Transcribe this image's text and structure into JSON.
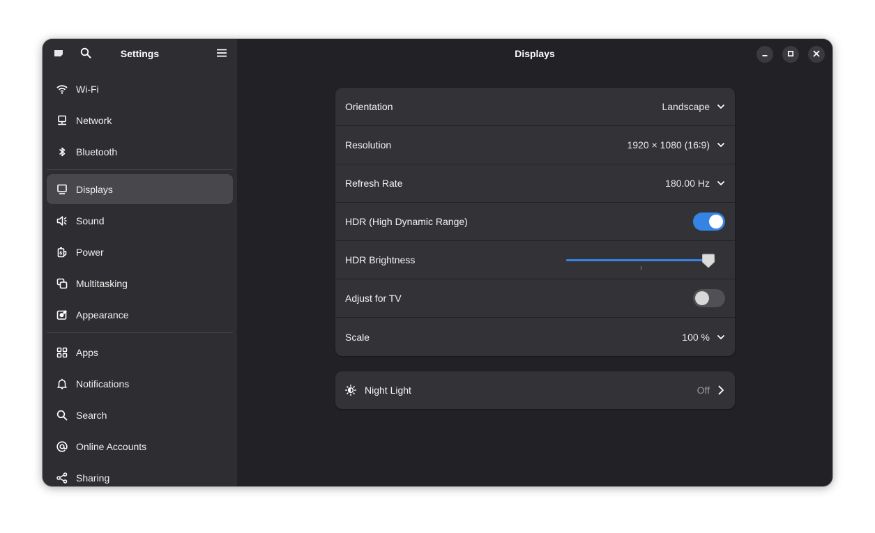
{
  "sidebar": {
    "title": "Settings",
    "groups": [
      [
        {
          "label": "Wi-Fi",
          "icon": "wifi-icon"
        },
        {
          "label": "Network",
          "icon": "network-icon"
        },
        {
          "label": "Bluetooth",
          "icon": "bluetooth-icon"
        }
      ],
      [
        {
          "label": "Displays",
          "icon": "display-icon",
          "active": true
        },
        {
          "label": "Sound",
          "icon": "sound-icon"
        },
        {
          "label": "Power",
          "icon": "power-icon"
        },
        {
          "label": "Multitasking",
          "icon": "multitasking-icon"
        },
        {
          "label": "Appearance",
          "icon": "appearance-icon"
        }
      ],
      [
        {
          "label": "Apps",
          "icon": "apps-icon"
        },
        {
          "label": "Notifications",
          "icon": "bell-icon"
        },
        {
          "label": "Search",
          "icon": "search-icon"
        },
        {
          "label": "Online Accounts",
          "icon": "at-icon"
        },
        {
          "label": "Sharing",
          "icon": "share-icon"
        }
      ]
    ]
  },
  "content": {
    "title": "Displays",
    "settings": {
      "orientation": {
        "label": "Orientation",
        "value": "Landscape"
      },
      "resolution": {
        "label": "Resolution",
        "value": "1920 × 1080 (16∶9)"
      },
      "refresh_rate": {
        "label": "Refresh Rate",
        "value": "180.00 Hz"
      },
      "hdr": {
        "label": "HDR (High Dynamic Range)",
        "enabled": true
      },
      "hdr_brightness": {
        "label": "HDR Brightness",
        "level": 1.0,
        "mark": 0.5
      },
      "adjust_tv": {
        "label": "Adjust for TV",
        "enabled": false
      },
      "scale": {
        "label": "Scale",
        "value": "100 %"
      }
    },
    "night_light": {
      "label": "Night Light",
      "value": "Off"
    }
  },
  "colors": {
    "accent": "#3584e4",
    "window_bg": "#222226",
    "sidebar_bg": "#2e2e32",
    "card_bg": "#333337"
  }
}
